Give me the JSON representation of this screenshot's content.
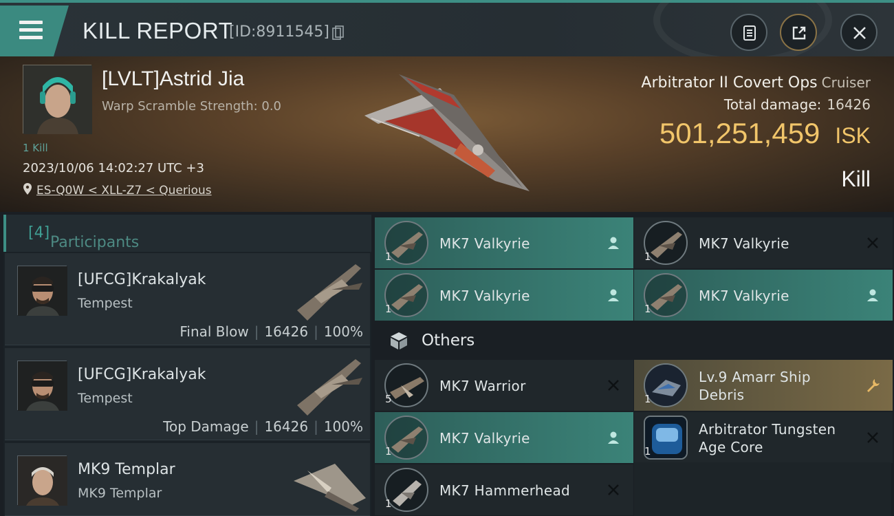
{
  "header": {
    "title": "KILL REPORT",
    "report_id": "[ID:8911545]",
    "icons": [
      "menu-icon",
      "copy-icon",
      "clipboard-icon",
      "share-icon",
      "close-icon"
    ]
  },
  "victim": {
    "name": "[LVLT]Astrid Jia",
    "warp_scramble": "Warp Scramble Strength: 0.0",
    "kills": "1 Kill",
    "datetime": "2023/10/06 14:02:27 UTC +3",
    "location": "ES-Q0W < XLL-Z7 < Querious"
  },
  "ship": {
    "name": "Arbitrator II Covert Ops",
    "class": "Cruiser",
    "total_damage_label": "Total damage:",
    "total_damage": "16426",
    "isk_value": "501,251,459",
    "isk_unit": "ISK",
    "result": "Kill"
  },
  "participants": {
    "label": "Participants",
    "count": "[4]",
    "list": [
      {
        "name": "[UFCG]Krakalyak",
        "ship": "Tempest",
        "role": "Final Blow",
        "damage": "16426",
        "percent": "100%"
      },
      {
        "name": "[UFCG]Krakalyak",
        "ship": "Tempest",
        "role": "Top Damage",
        "damage": "16426",
        "percent": "100%"
      },
      {
        "name": "MK9 Templar",
        "ship": "MK9 Templar"
      }
    ]
  },
  "fitted": [
    {
      "name": "MK7  Valkyrie",
      "qty": "1",
      "state": "teal",
      "action": "person-icon"
    },
    {
      "name": "MK7  Valkyrie",
      "qty": "1",
      "state": "dark",
      "action": "close-icon"
    },
    {
      "name": "MK7  Valkyrie",
      "qty": "1",
      "state": "teal",
      "action": "person-icon"
    },
    {
      "name": "MK7  Valkyrie",
      "qty": "1",
      "state": "teal",
      "action": "person-icon"
    }
  ],
  "others_label": "Others",
  "others": [
    {
      "name": "MK7  Warrior",
      "qty": "5",
      "state": "dark",
      "action": "close-icon"
    },
    {
      "name": "Lv.9 Amarr Ship Debris",
      "qty": "1",
      "state": "gold",
      "action": "wrench-icon"
    },
    {
      "name": "MK7  Valkyrie",
      "qty": "1",
      "state": "teal",
      "action": "person-icon"
    },
    {
      "name": "Arbitrator Tungsten Age Core",
      "qty": "1",
      "state": "dark",
      "action": "close-icon"
    },
    {
      "name": "MK7  Hammerhead",
      "qty": "1",
      "state": "dark",
      "action": "close-icon"
    }
  ],
  "colors": {
    "accent": "#3d8f85",
    "isk": "#f1c56a",
    "gold_slot": "#7a6a46"
  }
}
